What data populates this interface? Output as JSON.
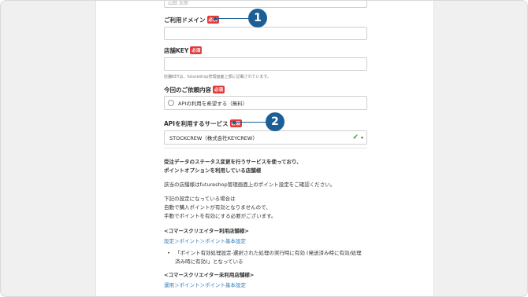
{
  "form": {
    "top_field_value": "山田 太郎",
    "domain_label": "ご利用ドメイン",
    "required_tag": "必須",
    "shopkey_label": "店舗KEY",
    "shopkey_hint": "店舗KEYは、futureshop管理画面上部に記載されています。",
    "request_label": "今回のご依頼内容",
    "request_option": "APIの利用を希望する（無料）",
    "api_service_label": "APIを利用するサービス",
    "api_service_value": "STOCKCREW（株式会社KEYCREW）"
  },
  "callouts": {
    "one": "1",
    "two": "2"
  },
  "info": {
    "heading_line1": "受注データのステータス変更を行うサービスを使っており、",
    "heading_line2": "ポイントオプションを利用している店舗様",
    "para1": "該当の店舗様はfutureshop管理画面上のポイント設定をご確認ください。",
    "para2_line1": "下記の設定になっている場合は",
    "para2_line2": "自動で購入ポイントが有効となりませんので、",
    "para2_line3": "手動でポイントを有効にする必要がございます。",
    "section1_title": "<コマースクリエイター利用店舗様>",
    "section1_link": "設定＞ポイント＞ポイント基本設定",
    "bullet_line1": "「ポイント有効処理設定-選択された処理の実行時に有効 (発送済み時に有効/処理",
    "bullet_line2": "済み時に有効)」となっている",
    "section2_title": "<コマースクリエイター未利用店舗様>",
    "section2_link": "運用＞ポイント＞ポイント基本設定"
  },
  "colors": {
    "required": "#e03a3a",
    "callout": "#1c5f96",
    "link": "#2a7bbd",
    "check": "#27a844"
  }
}
